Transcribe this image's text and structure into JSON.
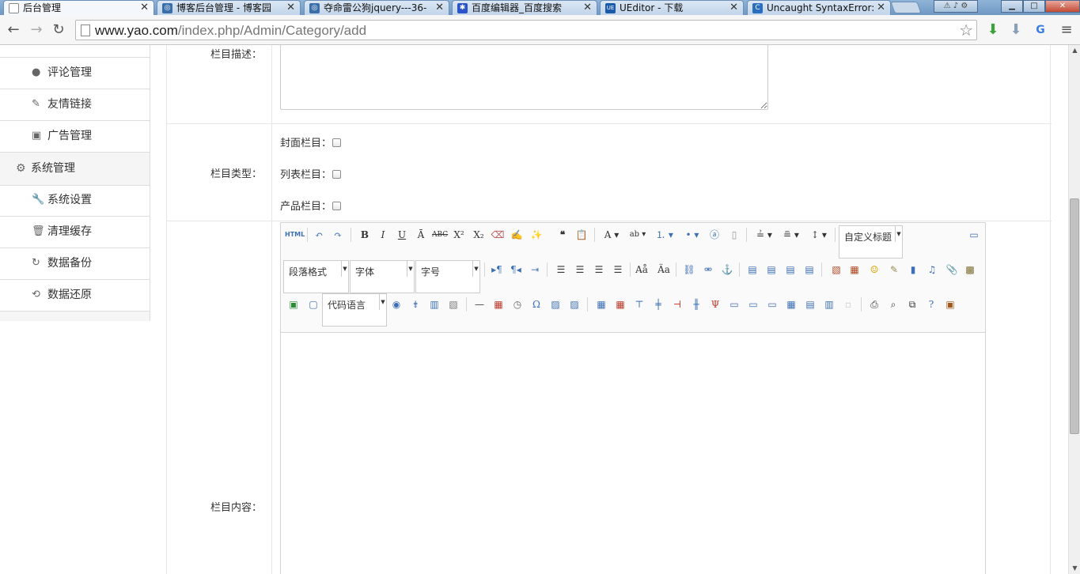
{
  "browser": {
    "tabs": [
      {
        "title": "后台管理",
        "active": true,
        "favicon": "page-icon"
      },
      {
        "title": "博客后台管理 - 博客园",
        "active": false,
        "favicon": "cnblogs-icon"
      },
      {
        "title": "夺命雷公狗jquery---36-",
        "active": false,
        "favicon": "cnblogs-icon"
      },
      {
        "title": "百度编辑器_百度搜索",
        "active": false,
        "favicon": "baidu-icon"
      },
      {
        "title": "UEditor - 下载",
        "active": false,
        "favicon": "ueditor-icon"
      },
      {
        "title": "Uncaught SyntaxError:",
        "active": false,
        "favicon": "search-icon"
      }
    ],
    "url_host": "www.yao.com",
    "url_path": "/index.php/Admin/Category/add"
  },
  "sidebar": {
    "items": [
      {
        "label": "评论管理",
        "icon": "comment-icon"
      },
      {
        "label": "友情链接",
        "icon": "link-icon"
      },
      {
        "label": "广告管理",
        "icon": "image-icon"
      }
    ],
    "group": {
      "label": "系统管理",
      "icon": "gear-icon"
    },
    "sub_items": [
      {
        "label": "系统设置",
        "icon": "wrench-icon"
      },
      {
        "label": "清理缓存",
        "icon": "trash-icon"
      },
      {
        "label": "数据备份",
        "icon": "refresh-icon"
      },
      {
        "label": "数据还原",
        "icon": "restore-icon"
      }
    ]
  },
  "form": {
    "description_label": "栏目描述：",
    "type_label": "栏目类型：",
    "type_options": [
      "封面栏目：",
      "列表栏目：",
      "产品栏目："
    ],
    "content_label": "栏目内容："
  },
  "editor": {
    "html_label": "HTML",
    "paragraph_combo": "段落格式",
    "font_combo": "字体",
    "size_combo": "字号",
    "custom_heading_combo": "自定义标题",
    "code_lang_combo": "代码语言"
  },
  "colors": {
    "accent": "#3d6fb4",
    "tab_bar": "#7aa2cb",
    "sidebar_group_bg": "#f5f5f5"
  }
}
